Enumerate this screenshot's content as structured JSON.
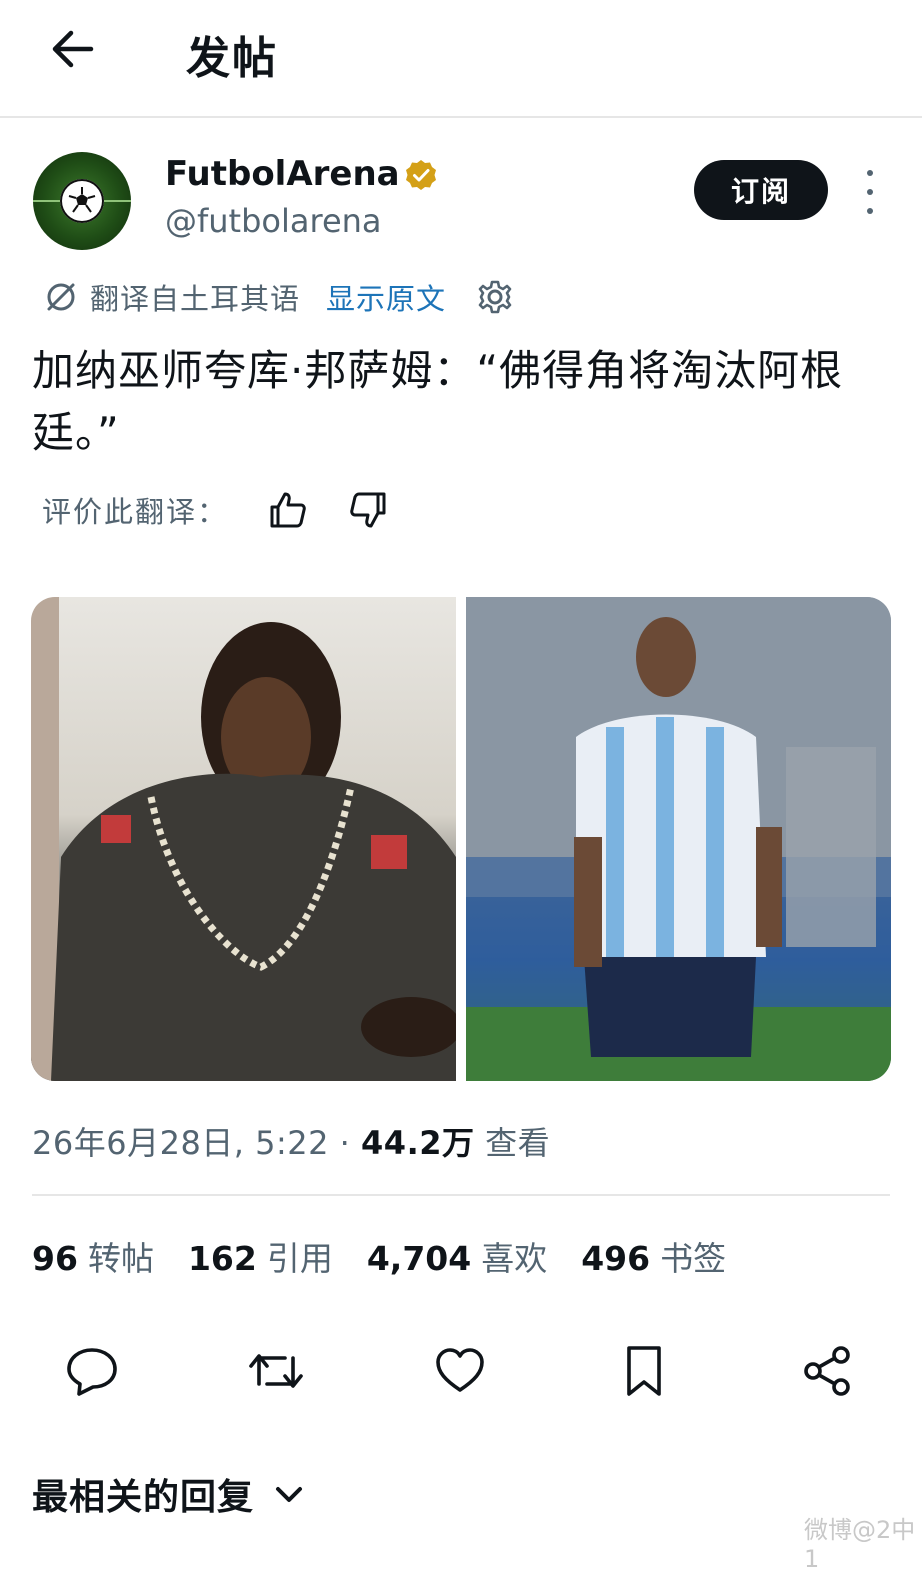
{
  "header": {
    "title": "发帖",
    "back_icon": "arrow-left-icon"
  },
  "author": {
    "display_name": "FutbolArena",
    "handle": "@futbolarena",
    "verified": true,
    "verified_color": "#d4a017",
    "subscribe_label": "订阅",
    "more_icon": "more-vertical-icon"
  },
  "translation": {
    "label": "翻译自土耳其语",
    "show_original": "显示原文",
    "link_color": "#1d74b8"
  },
  "post": {
    "text": "加纳巫师夸库·邦萨姆：“佛得角将淘汰阿根廷。”",
    "rate_label": "评价此翻译：",
    "images": [
      {
        "alt_icon": "photo-person-icon"
      },
      {
        "alt_icon": "photo-soccer-player-icon"
      }
    ]
  },
  "meta": {
    "timestamp": "26年6月28日, 5:22 · ",
    "views_count": "44.2万",
    "views_label": " 查看"
  },
  "stats": [
    {
      "count": "96",
      "label": "转帖"
    },
    {
      "count": "162",
      "label": "引用"
    },
    {
      "count": "4,704",
      "label": "喜欢"
    },
    {
      "count": "496",
      "label": "书签"
    }
  ],
  "actions": [
    "reply-icon",
    "retweet-icon",
    "like-icon",
    "bookmark-icon",
    "share-icon"
  ],
  "replies": {
    "title": "最相关的回复"
  },
  "watermark": "微博@2中1"
}
